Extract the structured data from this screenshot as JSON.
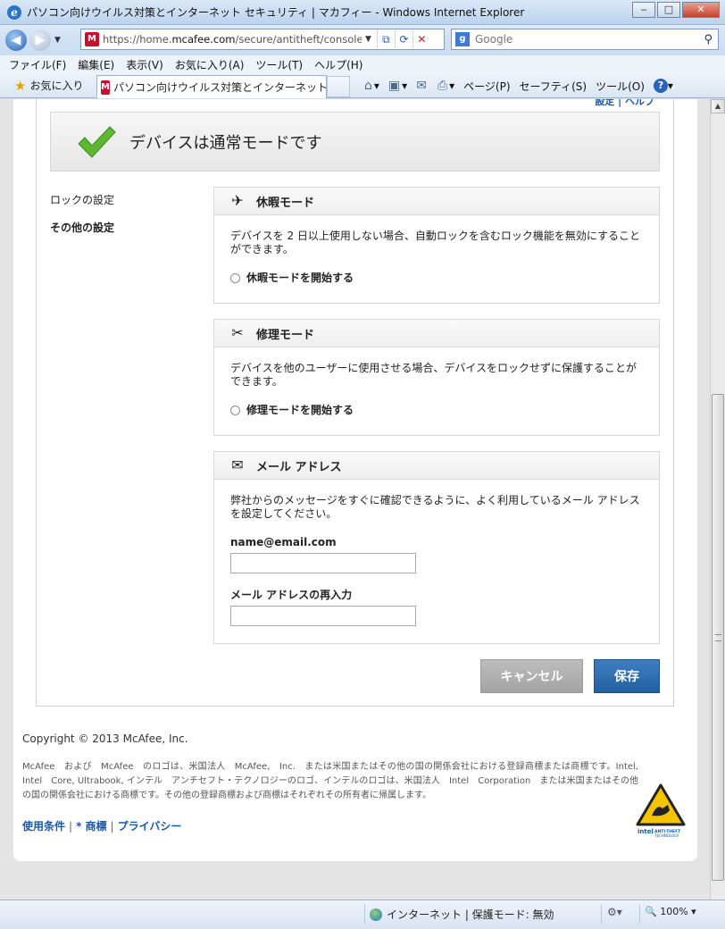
{
  "window": {
    "title": "パソコン向けウイルス対策とインターネット セキュリティ | マカフィー - Windows Internet Explorer",
    "buttons": {
      "minimize": "‒",
      "maximize": "□",
      "close": "✕"
    }
  },
  "address_bar": {
    "url_prefix": "https://home.",
    "url_host": "mcafee.com",
    "url_path": "/secure/antitheft/console.aspx",
    "site_icon": "mcafee-shield-icon"
  },
  "search": {
    "placeholder": "Google"
  },
  "menu": [
    "ファイル(F)",
    "編集(E)",
    "表示(V)",
    "お気に入り(A)",
    "ツール(T)",
    "ヘルプ(H)"
  ],
  "favorites_bar": {
    "favorites_label": "お気に入り",
    "tab_title": "パソコン向けウイルス対策とインターネット セキュ...",
    "commands": {
      "page": "ページ(P)",
      "safety": "セーフティ(S)",
      "tools": "ツール(O)"
    }
  },
  "page": {
    "top_links_cut": "設定 | ヘルプ",
    "status_banner": "デバイスは通常モードです",
    "left_nav": {
      "lock_settings": "ロックの設定",
      "other_settings": "その他の設定"
    },
    "vacation": {
      "title": "休暇モード",
      "description": "デバイスを 2 日以上使用しない場合、自動ロックを含むロック機能を無効にすることができます。",
      "option": "休暇モードを開始する"
    },
    "repair": {
      "title": "修理モード",
      "description": "デバイスを他のユーザーに使用させる場合、デバイスをロックせずに保護することができます。",
      "option": "修理モードを開始する"
    },
    "email": {
      "title": "メール アドレス",
      "description": "弊社からのメッセージをすぐに確認できるように、よく利用しているメール アドレスを設定してください。",
      "email_label": "name@email.com",
      "email_value": "",
      "confirm_label": "メール アドレスの再入力",
      "confirm_value": ""
    },
    "buttons": {
      "cancel": "キャンセル",
      "save": "保存"
    },
    "footer": {
      "copyright": "Copyright © 2013 McAfee, Inc.",
      "legal": "McAfee　および　McAfee　のロゴは、米国法人　McAfee,　Inc.　または米国またはその他の国の関係会社における登録商標または商標です。Intel, Intel　Core, Ultrabook, インテル　アンチセフト・テクノロジーのロゴ、インテルのロゴは、米国法人　Intel　Corporation　または米国またはその他の国の関係会社における商標です。その他の登録商標および商標はそれぞれその所有者に帰属します。",
      "links": {
        "terms": "使用条件",
        "trademark": "* 商標",
        "privacy": "プライバシー"
      },
      "badge_text": {
        "intel": "intel",
        "line1": "ANTI-THEFT",
        "line2": "TECHNOLOGY"
      }
    }
  },
  "statusbar": {
    "zone": "インターネット | 保護モード: 無効",
    "zoom": "100%"
  }
}
